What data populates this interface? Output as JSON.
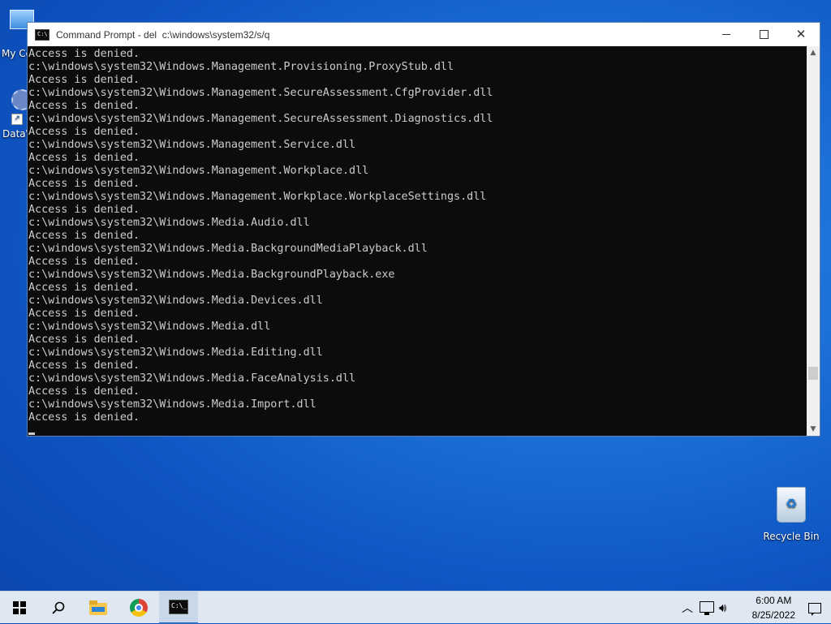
{
  "desktop": {
    "icons": [
      {
        "label": "My Co"
      },
      {
        "label": "DataW"
      },
      {
        "label": "Recycle Bin"
      }
    ]
  },
  "window": {
    "title": "Command Prompt - del  c:\\windows\\system32/s/q",
    "console_lines": [
      "Access is denied.",
      "c:\\windows\\system32\\Windows.Management.Provisioning.ProxyStub.dll",
      "Access is denied.",
      "c:\\windows\\system32\\Windows.Management.SecureAssessment.CfgProvider.dll",
      "Access is denied.",
      "c:\\windows\\system32\\Windows.Management.SecureAssessment.Diagnostics.dll",
      "Access is denied.",
      "c:\\windows\\system32\\Windows.Management.Service.dll",
      "Access is denied.",
      "c:\\windows\\system32\\Windows.Management.Workplace.dll",
      "Access is denied.",
      "c:\\windows\\system32\\Windows.Management.Workplace.WorkplaceSettings.dll",
      "Access is denied.",
      "c:\\windows\\system32\\Windows.Media.Audio.dll",
      "Access is denied.",
      "c:\\windows\\system32\\Windows.Media.BackgroundMediaPlayback.dll",
      "Access is denied.",
      "c:\\windows\\system32\\Windows.Media.BackgroundPlayback.exe",
      "Access is denied.",
      "c:\\windows\\system32\\Windows.Media.Devices.dll",
      "Access is denied.",
      "c:\\windows\\system32\\Windows.Media.dll",
      "Access is denied.",
      "c:\\windows\\system32\\Windows.Media.Editing.dll",
      "Access is denied.",
      "c:\\windows\\system32\\Windows.Media.FaceAnalysis.dll",
      "Access is denied.",
      "c:\\windows\\system32\\Windows.Media.Import.dll",
      "Access is denied."
    ]
  },
  "taskbar": {
    "time": "6:00 AM",
    "date": "8/25/2022"
  },
  "icons": {
    "start": "windows-logo-icon",
    "search": "search-icon",
    "explorer": "file-explorer-icon",
    "chrome": "chrome-icon",
    "cmd": "command-prompt-icon"
  }
}
